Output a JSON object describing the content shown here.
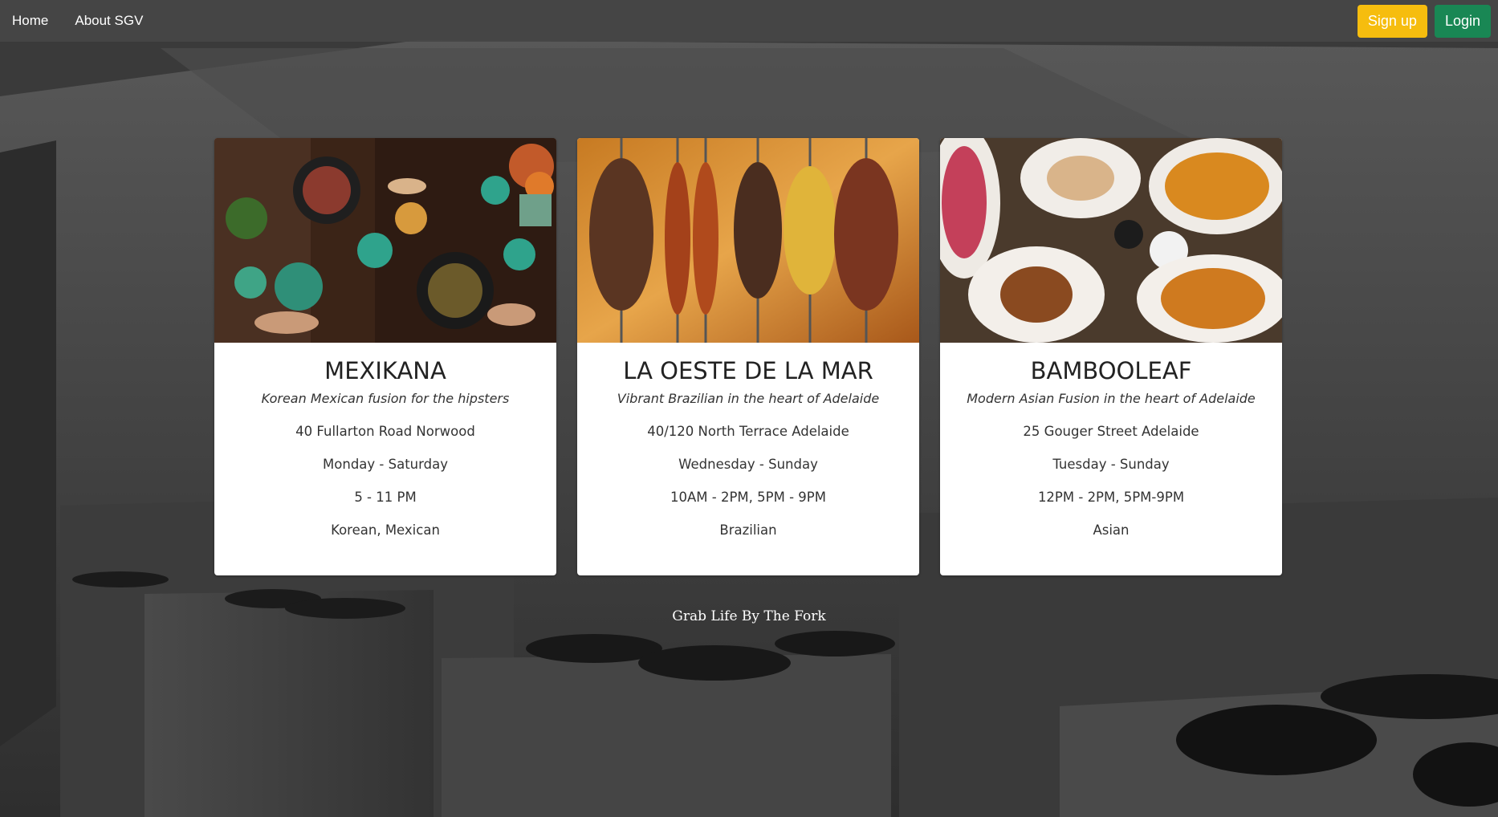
{
  "nav": {
    "home": "Home",
    "about": "About SGV",
    "signup": "Sign up",
    "login": "Login"
  },
  "restaurants": [
    {
      "name": "MEXIKANA",
      "tagline": "Korean Mexican fusion for the hipsters",
      "address": "40 Fullarton Road Norwood",
      "days": "Monday - Saturday",
      "hours": "5 - 11 PM",
      "cuisine": "Korean, Mexican",
      "image_icon": "food-table-photo"
    },
    {
      "name": "LA OESTE DE LA MAR",
      "tagline": "Vibrant Brazilian in the heart of Adelaide",
      "address": "40/120 North Terrace Adelaide",
      "days": "Wednesday - Sunday",
      "hours": "10AM - 2PM, 5PM - 9PM",
      "cuisine": "Brazilian",
      "image_icon": "skewers-photo"
    },
    {
      "name": "BAMBOOLEAF",
      "tagline": "Modern Asian Fusion in the heart of Adelaide",
      "address": "25 Gouger Street Adelaide",
      "days": "Tuesday - Sunday",
      "hours": "12PM - 2PM, 5PM-9PM",
      "cuisine": "Asian",
      "image_icon": "asian-dishes-photo"
    }
  ],
  "footer": {
    "slogan": "Grab Life By The Fork"
  },
  "colors": {
    "signup": "#f6bd0e",
    "login": "#198754",
    "navbar": "#464646"
  }
}
